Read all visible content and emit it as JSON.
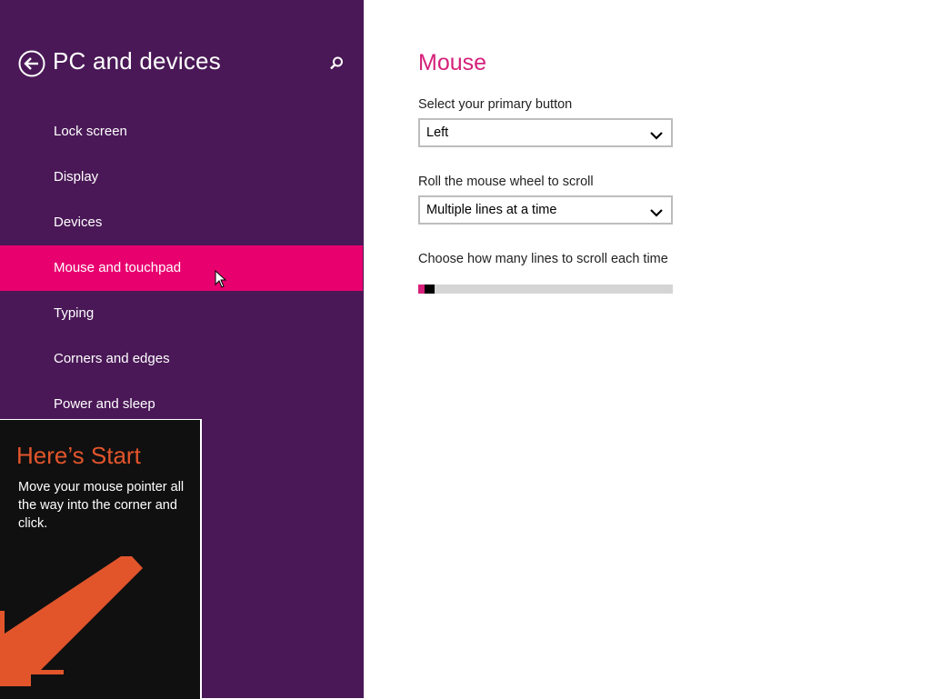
{
  "sidebar": {
    "title": "PC and devices",
    "back_icon": "back-arrow-circle-icon",
    "search_icon": "search-icon",
    "background_color": "#4a1857",
    "items": [
      {
        "label": "Lock screen",
        "active": false
      },
      {
        "label": "Display",
        "active": false
      },
      {
        "label": "Devices",
        "active": false
      },
      {
        "label": "Mouse and touchpad",
        "active": true
      },
      {
        "label": "Typing",
        "active": false
      },
      {
        "label": "Corners and edges",
        "active": false
      },
      {
        "label": "Power and sleep",
        "active": false
      }
    ],
    "active_color": "#e8006f"
  },
  "start_tip": {
    "title": "Here’s Start",
    "body": "Move your mouse pointer all the way into the corner and click.",
    "arrow_icon": "diagonal-arrow-down-left-icon",
    "accent_color": "#e2552b"
  },
  "main": {
    "section_title": "Mouse",
    "accent_color": "#d6207a",
    "primary_button": {
      "label": "Select your primary button",
      "value": "Left"
    },
    "wheel_scroll": {
      "label": "Roll the mouse wheel to scroll",
      "value": "Multiple lines at a time"
    },
    "lines_to_scroll": {
      "label": "Choose how many lines to scroll each time",
      "level_fraction": 0.01
    }
  }
}
